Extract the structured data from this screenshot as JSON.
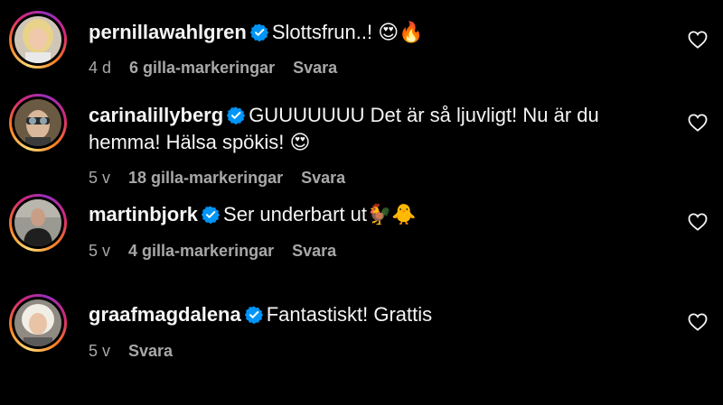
{
  "comments": [
    {
      "username": "pernillawahlgren",
      "text": "Slottsfrun..! 😍🔥",
      "time": "4 d",
      "likes": "6 gilla-markeringar",
      "reply": "Svara"
    },
    {
      "username": "carinalillyberg",
      "text": "GUUUUUUU Det är så ljuvligt! Nu är du hemma! Hälsa spökis! 😍",
      "time": "5 v",
      "likes": "18 gilla-markeringar",
      "reply": "Svara"
    },
    {
      "username": "martinbjork",
      "text": "Ser underbart ut🐓🐥",
      "time": "5 v",
      "likes": "4 gilla-markeringar",
      "reply": "Svara"
    },
    {
      "username": "graafmagdalena",
      "text": "Fantastiskt! Grattis",
      "time": "5 v",
      "reply": "Svara"
    }
  ],
  "icons": {
    "verified": "verified-badge-icon",
    "like": "heart-outline-icon"
  },
  "colors": {
    "verified": "#0095f6",
    "meta": "#a8a8a8",
    "background": "#000000"
  }
}
